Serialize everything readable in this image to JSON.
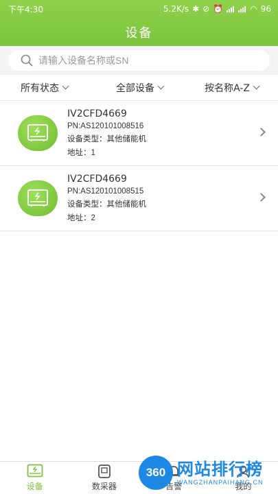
{
  "status_bar": {
    "time": "下午4:30",
    "speed": "5.2K/s",
    "battery": "96"
  },
  "header": {
    "title": "设备"
  },
  "search": {
    "placeholder": "请输入设备名称或SN"
  },
  "filters": [
    {
      "label": "所有状态"
    },
    {
      "label": "全部设备"
    },
    {
      "label": "按名称A-Z"
    }
  ],
  "devices": [
    {
      "name": "IV2CFD4669",
      "pn": "PN:AS120101008516",
      "type": "设备类型：其他储能机",
      "address": "地址：1"
    },
    {
      "name": "IV2CFD4669",
      "pn": "PN:AS120101008515",
      "type": "设备类型：其他储能机",
      "address": "地址：2"
    }
  ],
  "nav": [
    {
      "label": "设备",
      "icon": "device-icon",
      "active": true
    },
    {
      "label": "数采器",
      "icon": "collector-icon",
      "active": false
    },
    {
      "label": "告警",
      "icon": "alarm-icon",
      "active": false
    },
    {
      "label": "我的",
      "icon": "profile-icon",
      "active": false
    }
  ],
  "watermark": {
    "badge": "360",
    "text": "网站排行榜",
    "sub": "WANGZHANPAIHANG.CN"
  },
  "colors": {
    "accent": "#7cc43c",
    "watermark": "#1e88e5"
  }
}
